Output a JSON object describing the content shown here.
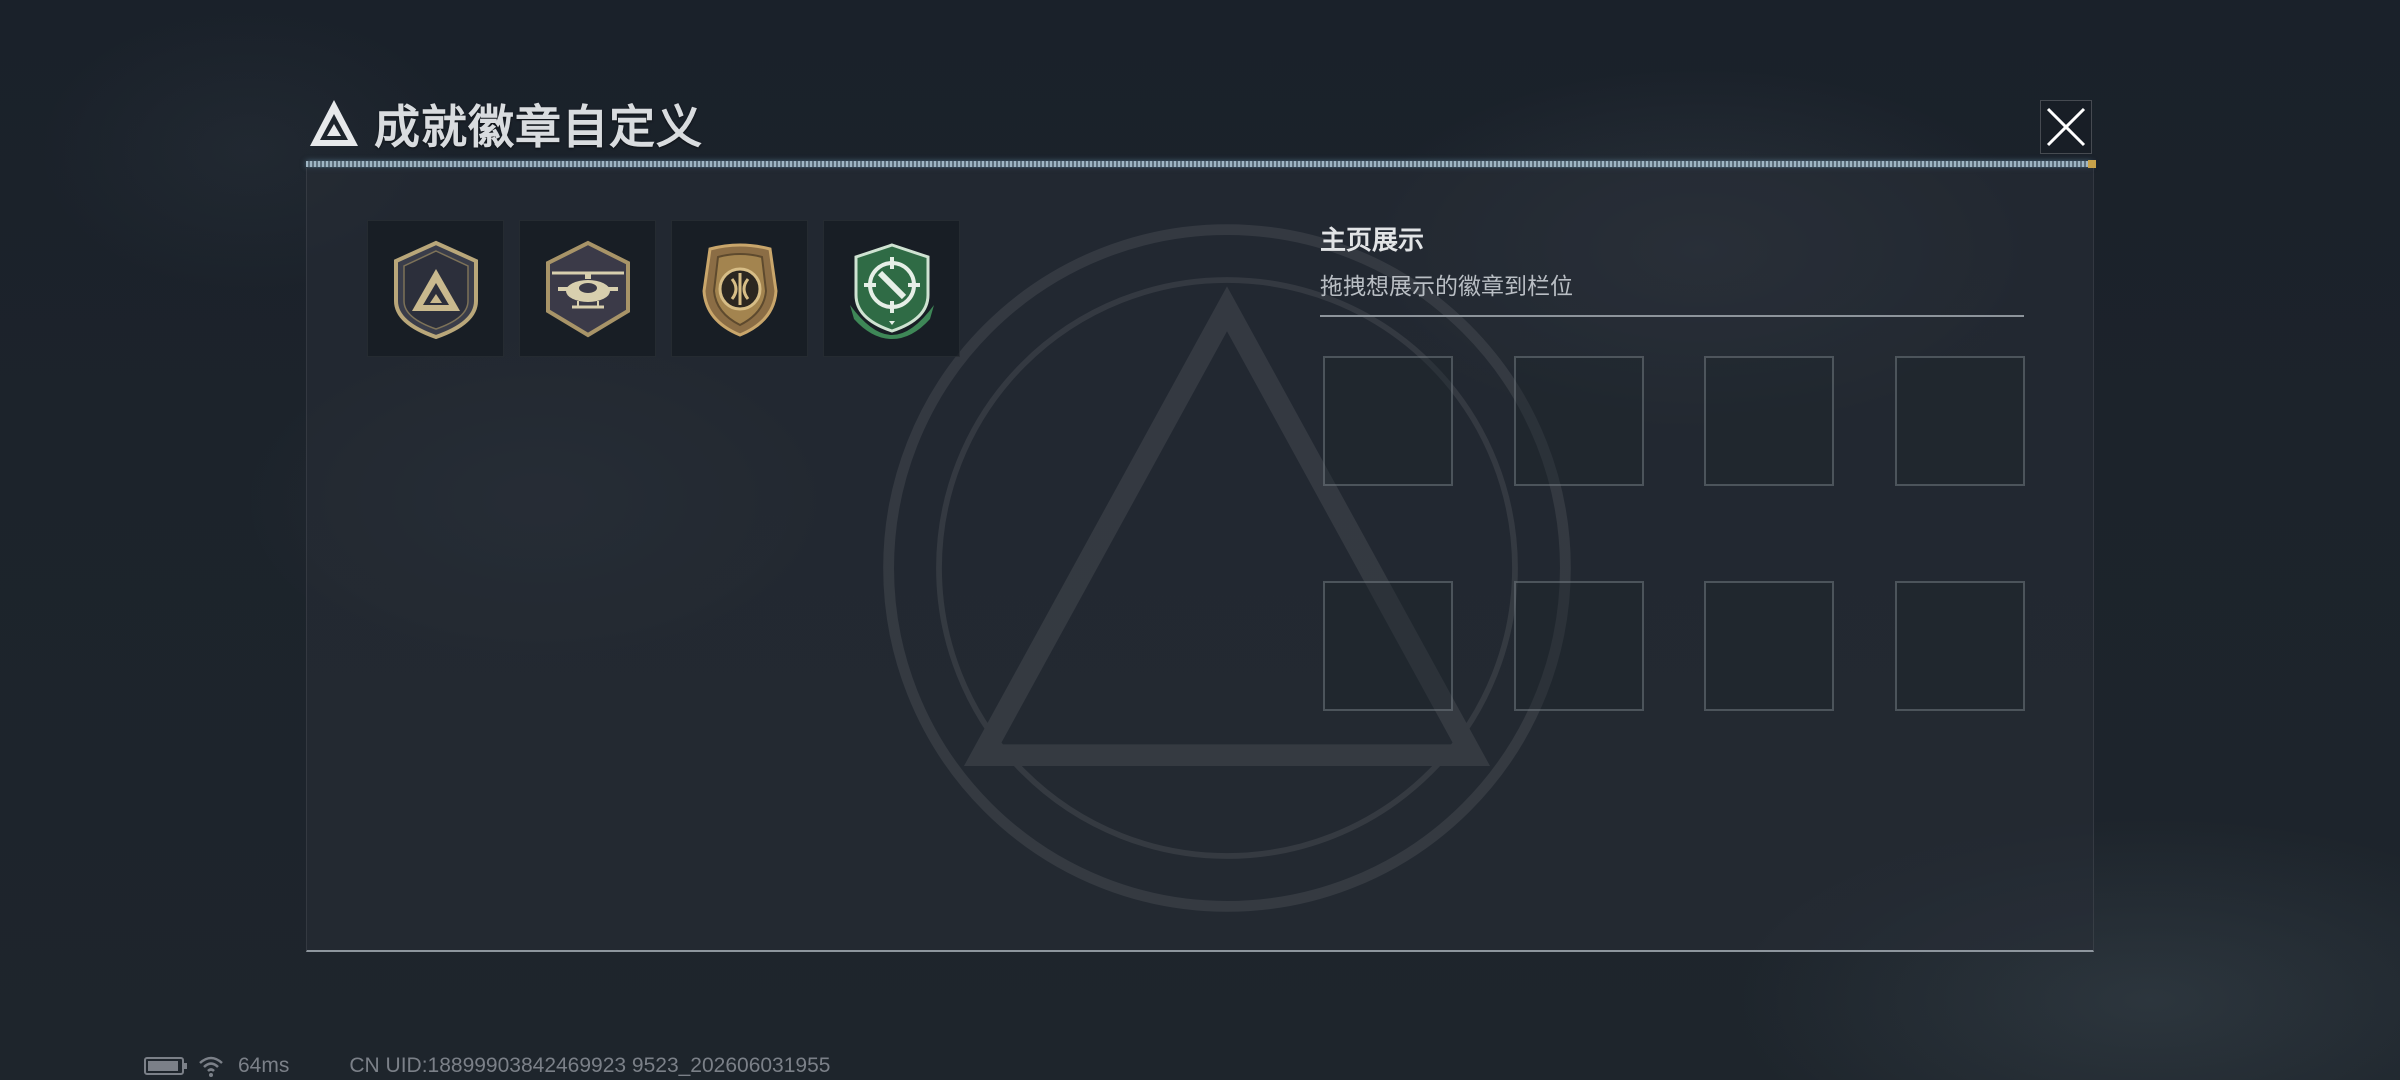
{
  "header": {
    "title": "成就徽章自定义",
    "close_label": "Close"
  },
  "badges": [
    {
      "name": "triangle-emblem-badge"
    },
    {
      "name": "helicopter-badge"
    },
    {
      "name": "bronze-shield-badge"
    },
    {
      "name": "green-crosshair-badge"
    }
  ],
  "display": {
    "title": "主页展示",
    "subtitle": "拖拽想展示的徽章到栏位",
    "slot_count": 8
  },
  "status_bar": {
    "ping": "64ms",
    "uid": "CN UID:18899903842469923 9523_202606031955"
  },
  "colors": {
    "accent_gold": "#c8a24a",
    "badge_green": "#2f6b45",
    "panel_border": "#8e969e"
  }
}
